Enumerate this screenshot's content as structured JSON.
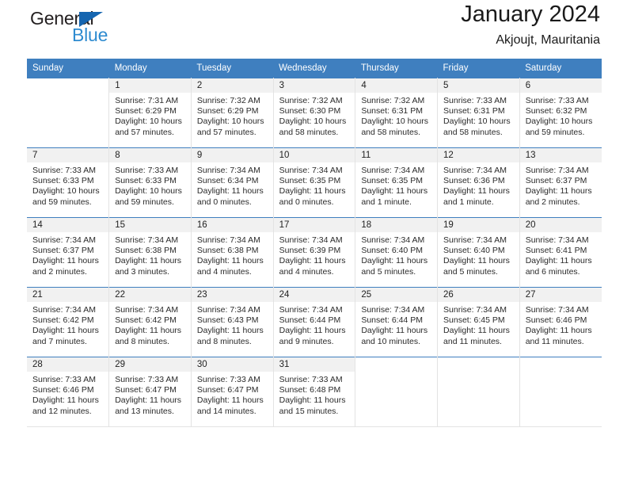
{
  "brand": {
    "name_top": "General",
    "name_bottom": "Blue",
    "triangle_icon": "triangle-icon",
    "color_dark": "#231f20",
    "color_blue": "#2e8bd0",
    "color_triangle": "#1565b0"
  },
  "header": {
    "title": "January 2024",
    "subtitle": "Akjoujt, Mauritania"
  },
  "theme": {
    "header_band": "#3f7fbf",
    "daynum_band": "#f1f1f1",
    "cell_border": "#e3e3e3"
  },
  "calendar": {
    "weekday_headers": [
      "Sunday",
      "Monday",
      "Tuesday",
      "Wednesday",
      "Thursday",
      "Friday",
      "Saturday"
    ],
    "weeks": [
      [
        {
          "day": "",
          "empty": true,
          "sunrise": "",
          "sunset": "",
          "daylight_line1": "",
          "daylight_line2": ""
        },
        {
          "day": "1",
          "sunrise": "Sunrise: 7:31 AM",
          "sunset": "Sunset: 6:29 PM",
          "daylight_line1": "Daylight: 10 hours",
          "daylight_line2": "and 57 minutes."
        },
        {
          "day": "2",
          "sunrise": "Sunrise: 7:32 AM",
          "sunset": "Sunset: 6:29 PM",
          "daylight_line1": "Daylight: 10 hours",
          "daylight_line2": "and 57 minutes."
        },
        {
          "day": "3",
          "sunrise": "Sunrise: 7:32 AM",
          "sunset": "Sunset: 6:30 PM",
          "daylight_line1": "Daylight: 10 hours",
          "daylight_line2": "and 58 minutes."
        },
        {
          "day": "4",
          "sunrise": "Sunrise: 7:32 AM",
          "sunset": "Sunset: 6:31 PM",
          "daylight_line1": "Daylight: 10 hours",
          "daylight_line2": "and 58 minutes."
        },
        {
          "day": "5",
          "sunrise": "Sunrise: 7:33 AM",
          "sunset": "Sunset: 6:31 PM",
          "daylight_line1": "Daylight: 10 hours",
          "daylight_line2": "and 58 minutes."
        },
        {
          "day": "6",
          "sunrise": "Sunrise: 7:33 AM",
          "sunset": "Sunset: 6:32 PM",
          "daylight_line1": "Daylight: 10 hours",
          "daylight_line2": "and 59 minutes."
        }
      ],
      [
        {
          "day": "7",
          "sunrise": "Sunrise: 7:33 AM",
          "sunset": "Sunset: 6:33 PM",
          "daylight_line1": "Daylight: 10 hours",
          "daylight_line2": "and 59 minutes."
        },
        {
          "day": "8",
          "sunrise": "Sunrise: 7:33 AM",
          "sunset": "Sunset: 6:33 PM",
          "daylight_line1": "Daylight: 10 hours",
          "daylight_line2": "and 59 minutes."
        },
        {
          "day": "9",
          "sunrise": "Sunrise: 7:34 AM",
          "sunset": "Sunset: 6:34 PM",
          "daylight_line1": "Daylight: 11 hours",
          "daylight_line2": "and 0 minutes."
        },
        {
          "day": "10",
          "sunrise": "Sunrise: 7:34 AM",
          "sunset": "Sunset: 6:35 PM",
          "daylight_line1": "Daylight: 11 hours",
          "daylight_line2": "and 0 minutes."
        },
        {
          "day": "11",
          "sunrise": "Sunrise: 7:34 AM",
          "sunset": "Sunset: 6:35 PM",
          "daylight_line1": "Daylight: 11 hours",
          "daylight_line2": "and 1 minute."
        },
        {
          "day": "12",
          "sunrise": "Sunrise: 7:34 AM",
          "sunset": "Sunset: 6:36 PM",
          "daylight_line1": "Daylight: 11 hours",
          "daylight_line2": "and 1 minute."
        },
        {
          "day": "13",
          "sunrise": "Sunrise: 7:34 AM",
          "sunset": "Sunset: 6:37 PM",
          "daylight_line1": "Daylight: 11 hours",
          "daylight_line2": "and 2 minutes."
        }
      ],
      [
        {
          "day": "14",
          "sunrise": "Sunrise: 7:34 AM",
          "sunset": "Sunset: 6:37 PM",
          "daylight_line1": "Daylight: 11 hours",
          "daylight_line2": "and 2 minutes."
        },
        {
          "day": "15",
          "sunrise": "Sunrise: 7:34 AM",
          "sunset": "Sunset: 6:38 PM",
          "daylight_line1": "Daylight: 11 hours",
          "daylight_line2": "and 3 minutes."
        },
        {
          "day": "16",
          "sunrise": "Sunrise: 7:34 AM",
          "sunset": "Sunset: 6:38 PM",
          "daylight_line1": "Daylight: 11 hours",
          "daylight_line2": "and 4 minutes."
        },
        {
          "day": "17",
          "sunrise": "Sunrise: 7:34 AM",
          "sunset": "Sunset: 6:39 PM",
          "daylight_line1": "Daylight: 11 hours",
          "daylight_line2": "and 4 minutes."
        },
        {
          "day": "18",
          "sunrise": "Sunrise: 7:34 AM",
          "sunset": "Sunset: 6:40 PM",
          "daylight_line1": "Daylight: 11 hours",
          "daylight_line2": "and 5 minutes."
        },
        {
          "day": "19",
          "sunrise": "Sunrise: 7:34 AM",
          "sunset": "Sunset: 6:40 PM",
          "daylight_line1": "Daylight: 11 hours",
          "daylight_line2": "and 5 minutes."
        },
        {
          "day": "20",
          "sunrise": "Sunrise: 7:34 AM",
          "sunset": "Sunset: 6:41 PM",
          "daylight_line1": "Daylight: 11 hours",
          "daylight_line2": "and 6 minutes."
        }
      ],
      [
        {
          "day": "21",
          "sunrise": "Sunrise: 7:34 AM",
          "sunset": "Sunset: 6:42 PM",
          "daylight_line1": "Daylight: 11 hours",
          "daylight_line2": "and 7 minutes."
        },
        {
          "day": "22",
          "sunrise": "Sunrise: 7:34 AM",
          "sunset": "Sunset: 6:42 PM",
          "daylight_line1": "Daylight: 11 hours",
          "daylight_line2": "and 8 minutes."
        },
        {
          "day": "23",
          "sunrise": "Sunrise: 7:34 AM",
          "sunset": "Sunset: 6:43 PM",
          "daylight_line1": "Daylight: 11 hours",
          "daylight_line2": "and 8 minutes."
        },
        {
          "day": "24",
          "sunrise": "Sunrise: 7:34 AM",
          "sunset": "Sunset: 6:44 PM",
          "daylight_line1": "Daylight: 11 hours",
          "daylight_line2": "and 9 minutes."
        },
        {
          "day": "25",
          "sunrise": "Sunrise: 7:34 AM",
          "sunset": "Sunset: 6:44 PM",
          "daylight_line1": "Daylight: 11 hours",
          "daylight_line2": "and 10 minutes."
        },
        {
          "day": "26",
          "sunrise": "Sunrise: 7:34 AM",
          "sunset": "Sunset: 6:45 PM",
          "daylight_line1": "Daylight: 11 hours",
          "daylight_line2": "and 11 minutes."
        },
        {
          "day": "27",
          "sunrise": "Sunrise: 7:34 AM",
          "sunset": "Sunset: 6:46 PM",
          "daylight_line1": "Daylight: 11 hours",
          "daylight_line2": "and 11 minutes."
        }
      ],
      [
        {
          "day": "28",
          "sunrise": "Sunrise: 7:33 AM",
          "sunset": "Sunset: 6:46 PM",
          "daylight_line1": "Daylight: 11 hours",
          "daylight_line2": "and 12 minutes."
        },
        {
          "day": "29",
          "sunrise": "Sunrise: 7:33 AM",
          "sunset": "Sunset: 6:47 PM",
          "daylight_line1": "Daylight: 11 hours",
          "daylight_line2": "and 13 minutes."
        },
        {
          "day": "30",
          "sunrise": "Sunrise: 7:33 AM",
          "sunset": "Sunset: 6:47 PM",
          "daylight_line1": "Daylight: 11 hours",
          "daylight_line2": "and 14 minutes."
        },
        {
          "day": "31",
          "sunrise": "Sunrise: 7:33 AM",
          "sunset": "Sunset: 6:48 PM",
          "daylight_line1": "Daylight: 11 hours",
          "daylight_line2": "and 15 minutes."
        },
        {
          "day": "",
          "empty": true,
          "sunrise": "",
          "sunset": "",
          "daylight_line1": "",
          "daylight_line2": ""
        },
        {
          "day": "",
          "empty": true,
          "sunrise": "",
          "sunset": "",
          "daylight_line1": "",
          "daylight_line2": ""
        },
        {
          "day": "",
          "empty": true,
          "sunrise": "",
          "sunset": "",
          "daylight_line1": "",
          "daylight_line2": ""
        }
      ]
    ]
  }
}
